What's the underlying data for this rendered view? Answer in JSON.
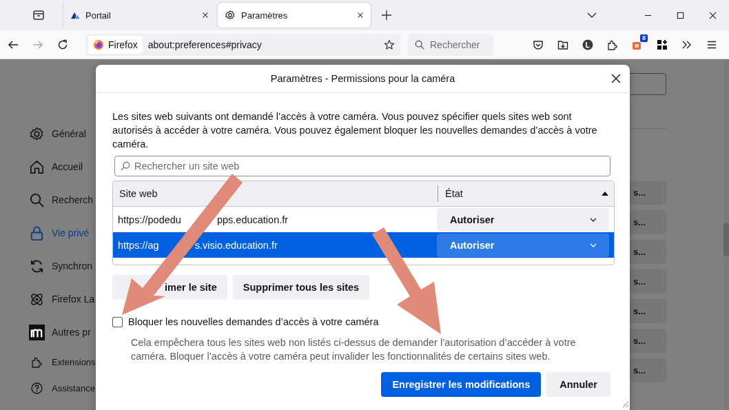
{
  "tabs": [
    {
      "title": "Portail",
      "selected": false
    },
    {
      "title": "Paramètres",
      "selected": true
    }
  ],
  "urlbar": {
    "identity": "Firefox",
    "url": "about:preferences#privacy"
  },
  "search": {
    "placeholder": "Rechercher"
  },
  "toolbar_badge": "8",
  "sidebar": [
    {
      "label": "Général",
      "selected": false
    },
    {
      "label": "Accueil",
      "selected": false
    },
    {
      "label": "Recherch",
      "selected": false
    },
    {
      "label": "Vie privé",
      "selected": true
    },
    {
      "label": "Synchron",
      "selected": false
    },
    {
      "label": "Firefox La",
      "selected": false
    },
    {
      "label": "Autres pr",
      "selected": false
    },
    {
      "label": "Extensions",
      "selected": false,
      "kind": "small"
    },
    {
      "label": "Assistance",
      "selected": false,
      "kind": "small"
    }
  ],
  "background": {
    "buttons": [
      "s...",
      "s...",
      "s...",
      "s...",
      "s...",
      "s...",
      "s..."
    ]
  },
  "dialog": {
    "title": "Paramètres - Permissions pour la caméra",
    "intro": "Les sites web suivants ont demandé l’accès à votre caméra. Vous pouvez spécifier quels sites web sont autorisés à accéder à votre caméra. Vous pouvez également bloquer les nouvelles demandes d’accès à votre caméra.",
    "search_placeholder": "Rechercher un site web",
    "columns": [
      "Site web",
      "État"
    ],
    "rows": [
      {
        "site_parts": [
          "https://podedu",
          "pps.education.fr"
        ],
        "status": "Autoriser",
        "selected": false
      },
      {
        "site_parts": [
          "https://ag",
          "s.visio.education.fr"
        ],
        "status": "Autoriser",
        "selected": true
      }
    ],
    "buttons": [
      "imer le site",
      "Supprimer tous les sites"
    ],
    "block": {
      "label": "Bloquer les nouvelles demandes d’accès à votre caméra",
      "checked": false,
      "description": "Cela empêchera tous les sites web non listés ci-dessus de demander l’autorisation d’accéder à votre caméra. Bloquer l’accès à votre caméra peut invalider les fonctionnalités de certains sites web."
    },
    "footer": [
      {
        "label": "Enregistrer les modifications",
        "kind": "primary"
      },
      {
        "label": "Annuler",
        "kind": "secondary"
      }
    ]
  }
}
